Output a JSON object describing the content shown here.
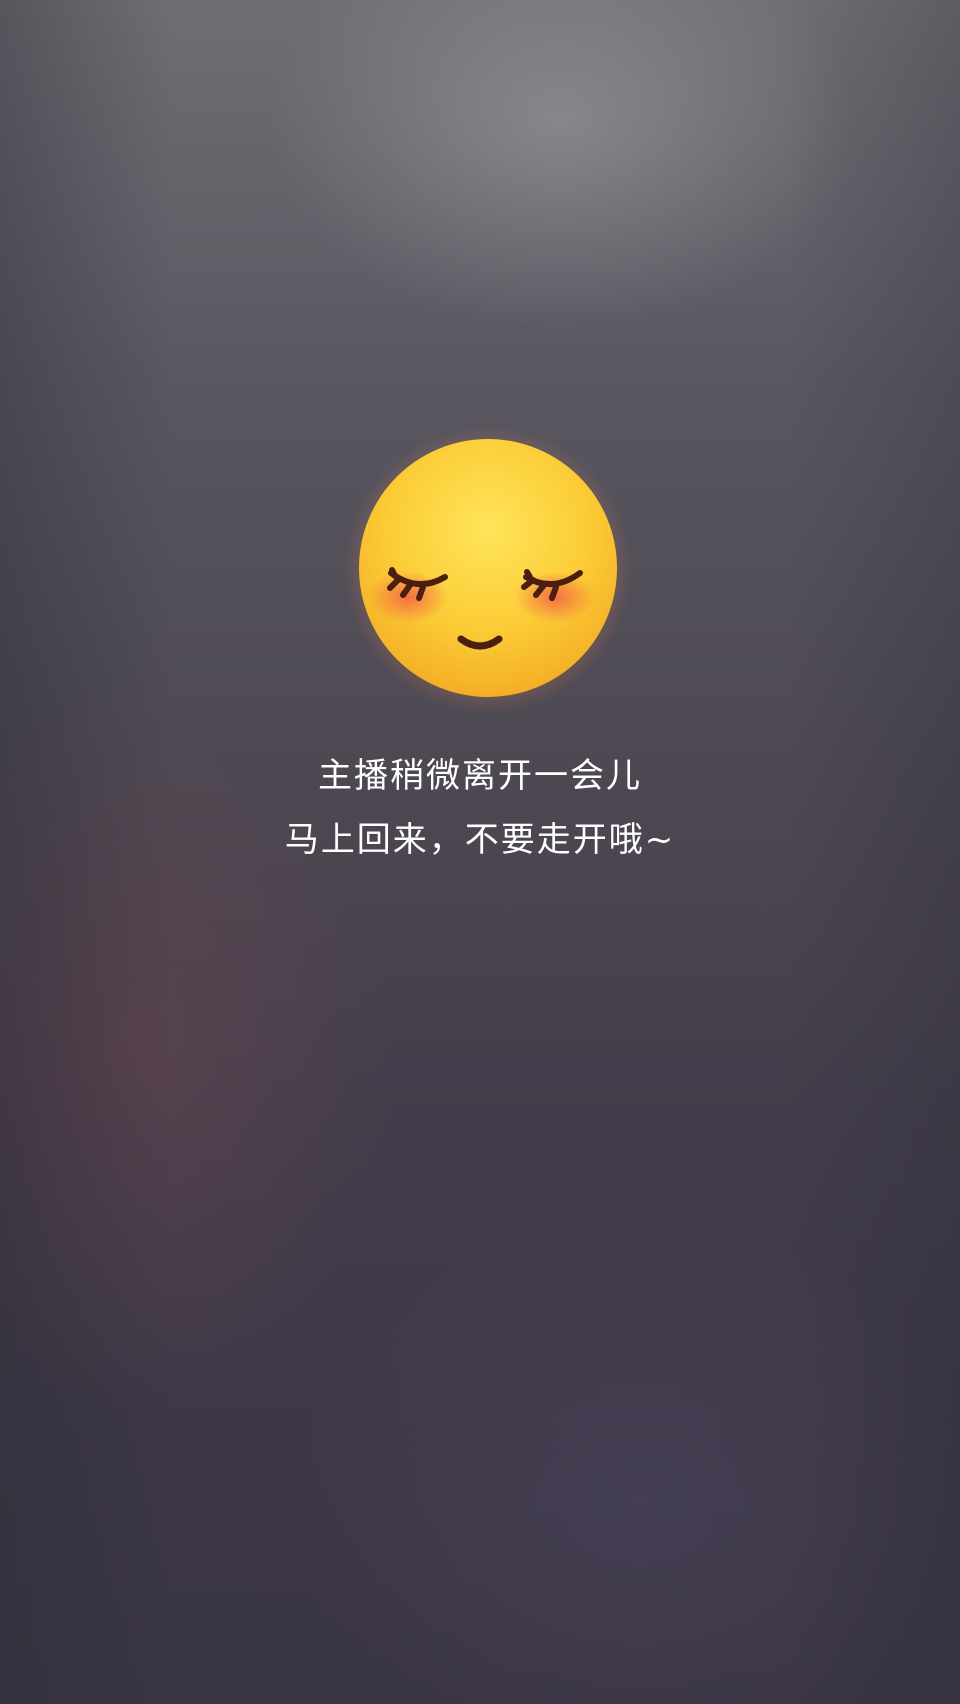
{
  "status": {
    "line1": "主播稍微离开一会儿",
    "line2": "马上回来，不要走开哦~"
  },
  "emoji": {
    "icon": "sleepy-blushing-face-icon",
    "face_color": "#f9c933",
    "blush_color": "#f36b4f",
    "feature_color": "#4a1f12"
  }
}
